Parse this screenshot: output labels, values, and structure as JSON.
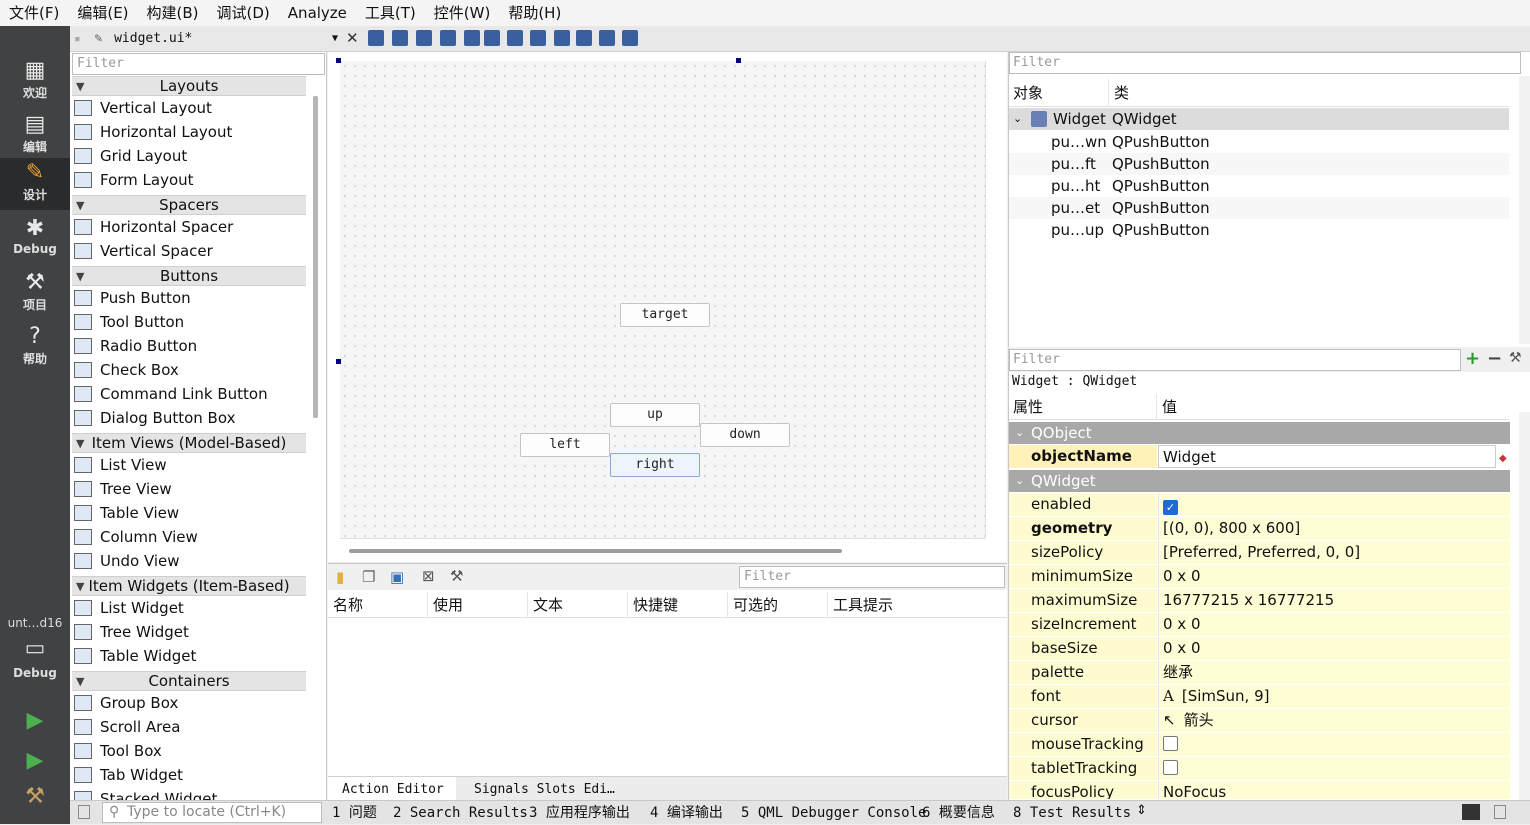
{
  "menubar": [
    "文件(F)",
    "编辑(E)",
    "构建(B)",
    "调试(D)",
    "Analyze",
    "工具(T)",
    "控件(W)",
    "帮助(H)"
  ],
  "modes": [
    {
      "label": "欢迎",
      "icon": "grid-icon"
    },
    {
      "label": "编辑",
      "icon": "document-icon"
    },
    {
      "label": "设计",
      "icon": "pencil-icon"
    },
    {
      "label": "Debug",
      "icon": "bug-icon"
    },
    {
      "label": "项目",
      "icon": "wrench-icon"
    },
    {
      "label": "帮助",
      "icon": "help-icon"
    }
  ],
  "kit": {
    "name": "unt…d16",
    "mode": "Debug"
  },
  "doc": {
    "file": "widget.ui*"
  },
  "widgetbox": {
    "filter_placeholder": "Filter",
    "categories": [
      {
        "name": "Layouts",
        "items": [
          "Vertical Layout",
          "Horizontal Layout",
          "Grid Layout",
          "Form Layout"
        ]
      },
      {
        "name": "Spacers",
        "items": [
          "Horizontal Spacer",
          "Vertical Spacer"
        ]
      },
      {
        "name": "Buttons",
        "items": [
          "Push Button",
          "Tool Button",
          "Radio Button",
          "Check Box",
          "Command Link Button",
          "Dialog Button Box"
        ]
      },
      {
        "name": "Item Views (Model-Based)",
        "items": [
          "List View",
          "Tree View",
          "Table View",
          "Column View",
          "Undo View"
        ]
      },
      {
        "name": "Item Widgets (Item-Based)",
        "items": [
          "List Widget",
          "Tree Widget",
          "Table Widget"
        ]
      },
      {
        "name": "Containers",
        "items": [
          "Group Box",
          "Scroll Area",
          "Tool Box",
          "Tab Widget",
          "Stacked Widget"
        ]
      }
    ]
  },
  "form": {
    "buttons": {
      "target": "target",
      "up": "up",
      "left": "left",
      "down": "down",
      "right": "right"
    }
  },
  "action_editor": {
    "filter_placeholder": "Filter",
    "columns": [
      "名称",
      "使用",
      "文本",
      "快捷键",
      "可选的",
      "工具提示"
    ],
    "tabs": [
      "Action Editor",
      "Signals  Slots Edi…"
    ]
  },
  "object_inspector": {
    "filter_placeholder": "Filter",
    "headers": [
      "对象",
      "类"
    ],
    "root": {
      "name": "Widget",
      "class": "QWidget"
    },
    "children": [
      {
        "name": "pu…wn",
        "class": "QPushButton"
      },
      {
        "name": "pu…ft",
        "class": "QPushButton"
      },
      {
        "name": "pu…ht",
        "class": "QPushButton"
      },
      {
        "name": "pu…et",
        "class": "QPushButton"
      },
      {
        "name": "pu…up",
        "class": "QPushButton"
      }
    ]
  },
  "property_editor": {
    "filter_placeholder": "Filter",
    "class_line": "Widget : QWidget",
    "headers": [
      "属性",
      "值"
    ],
    "groups": {
      "qobject": "QObject",
      "qwidget": "QWidget"
    },
    "object_name": {
      "name": "objectName",
      "value": "Widget"
    },
    "props": [
      {
        "name": "enabled",
        "value": "",
        "checkbox": true
      },
      {
        "name": "geometry",
        "value": "[(0, 0), 800 x 600]"
      },
      {
        "name": "sizePolicy",
        "value": "[Preferred, Preferred, 0, 0]"
      },
      {
        "name": "minimumSize",
        "value": "0 x 0"
      },
      {
        "name": "maximumSize",
        "value": "16777215 x 16777215"
      },
      {
        "name": "sizeIncrement",
        "value": "0 x 0"
      },
      {
        "name": "baseSize",
        "value": "0 x 0"
      },
      {
        "name": "palette",
        "value": "继承"
      },
      {
        "name": "font",
        "value": "[SimSun, 9]"
      },
      {
        "name": "cursor",
        "value": "箭头"
      },
      {
        "name": "mouseTracking",
        "value": "",
        "checkbox": false
      },
      {
        "name": "tabletTracking",
        "value": "",
        "checkbox": false
      },
      {
        "name": "focusPolicy",
        "value": "NoFocus"
      }
    ]
  },
  "statusbar": {
    "locator_placeholder": "Type to locate (Ctrl+K)",
    "tabs": [
      "1 问题",
      "2 Search Results",
      "3 应用程序输出",
      "4 编译输出",
      "5 QML Debugger Console",
      "6 概要信息",
      "8 Test Results"
    ]
  },
  "colors": {
    "accent": "#1e6ad6",
    "modebar": "#404244",
    "run": "#4caf50"
  }
}
